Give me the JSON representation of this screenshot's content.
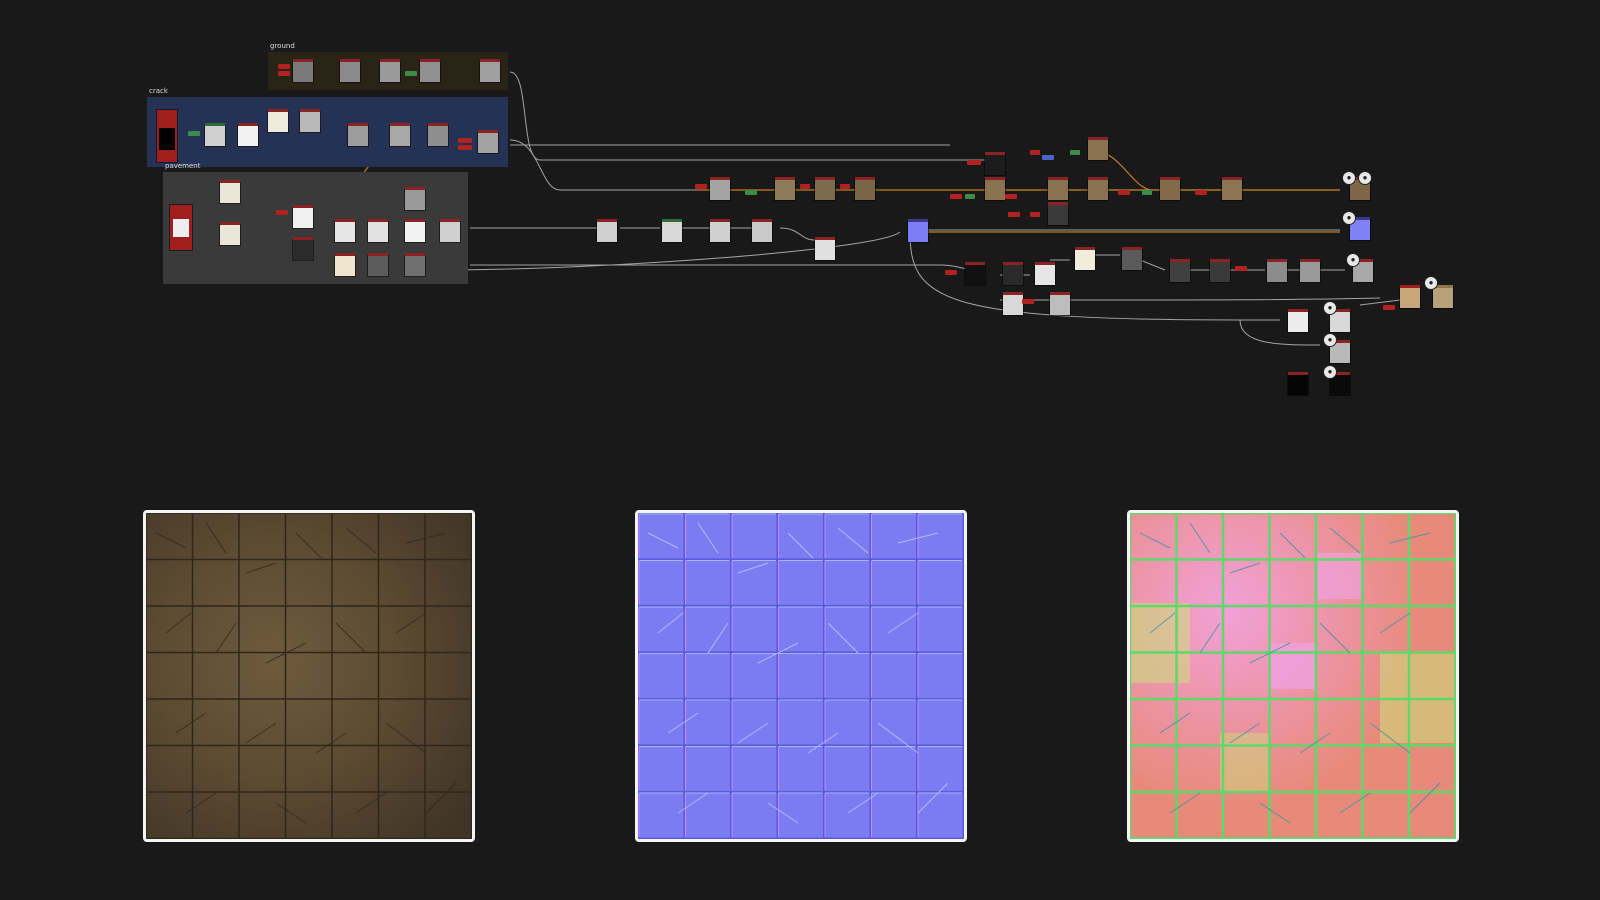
{
  "graph": {
    "frames": {
      "ground": "ground",
      "crack": "crack",
      "pavement": "pavement"
    }
  },
  "previews": {
    "base_color": "base-color-preview",
    "normal": "normal-map-preview",
    "mask": "mask-map-preview"
  },
  "colors": {
    "background": "#191919",
    "ground_frame": "#2a2416",
    "crack_frame": "#253253",
    "pavement_frame": "#3a3a3a",
    "wire": "#bdbdbd",
    "wire_accent": "#d08a22",
    "node_header": "#8a2323"
  }
}
